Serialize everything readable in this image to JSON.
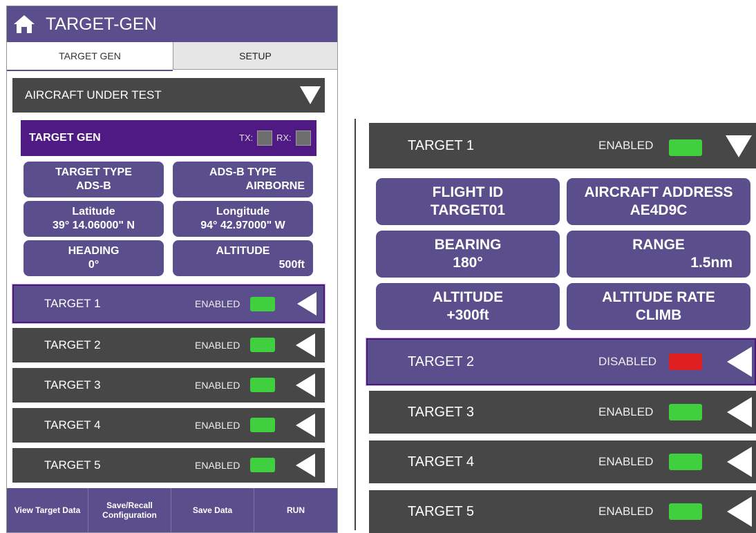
{
  "app": {
    "title": "TARGET-GEN",
    "home_icon": "home-icon"
  },
  "tabs": [
    {
      "label": "TARGET GEN",
      "active": true
    },
    {
      "label": "SETUP",
      "active": false
    }
  ],
  "aircraft_under_test": {
    "label": "AIRCRAFT UNDER TEST"
  },
  "target_gen": {
    "title": "TARGET GEN",
    "tx_label": "TX:",
    "rx_label": "RX:"
  },
  "params": [
    {
      "label": "TARGET TYPE",
      "value": "ADS-B"
    },
    {
      "label": "ADS-B TYPE",
      "value": "AIRBORNE"
    },
    {
      "label": "Latitude",
      "value": "39° 14.06000\" N"
    },
    {
      "label": "Longitude",
      "value": "94° 42.97000\" W"
    },
    {
      "label": "HEADING",
      "value": "0°"
    },
    {
      "label": "ALTITUDE",
      "value": "500ft"
    }
  ],
  "left_targets": [
    {
      "name": "TARGET 1",
      "status": "ENABLED",
      "selected": true
    },
    {
      "name": "TARGET 2",
      "status": "ENABLED",
      "selected": false
    },
    {
      "name": "TARGET 3",
      "status": "ENABLED",
      "selected": false
    },
    {
      "name": "TARGET 4",
      "status": "ENABLED",
      "selected": false
    },
    {
      "name": "TARGET 5",
      "status": "ENABLED",
      "selected": false
    }
  ],
  "bottom_buttons": [
    {
      "label": "View Target Data"
    },
    {
      "label": "Save/Recall Configuration"
    },
    {
      "label": "Save Data"
    },
    {
      "label": "RUN"
    }
  ],
  "right_panel": {
    "header": {
      "name": "TARGET 1",
      "status": "ENABLED"
    },
    "fields": [
      {
        "label": "FLIGHT ID",
        "value": "TARGET01"
      },
      {
        "label": "AIRCRAFT ADDRESS",
        "value": "AE4D9C"
      },
      {
        "label": "BEARING",
        "value": "180°"
      },
      {
        "label": "RANGE",
        "value": "1.5nm"
      },
      {
        "label": "ALTITUDE",
        "value": "+300ft"
      },
      {
        "label": "ALTITUDE RATE",
        "value": "CLIMB"
      }
    ],
    "targets": [
      {
        "name": "TARGET 2",
        "status": "DISABLED",
        "selected": true
      },
      {
        "name": "TARGET 3",
        "status": "ENABLED",
        "selected": false
      },
      {
        "name": "TARGET 4",
        "status": "ENABLED",
        "selected": false
      },
      {
        "name": "TARGET 5",
        "status": "ENABLED",
        "selected": false
      }
    ]
  },
  "colors": {
    "accent": "#5b4e8c",
    "dark_row": "#474747",
    "header_purple": "#4f1a84",
    "led_on": "#3fcf3f",
    "led_off": "#e02020"
  }
}
